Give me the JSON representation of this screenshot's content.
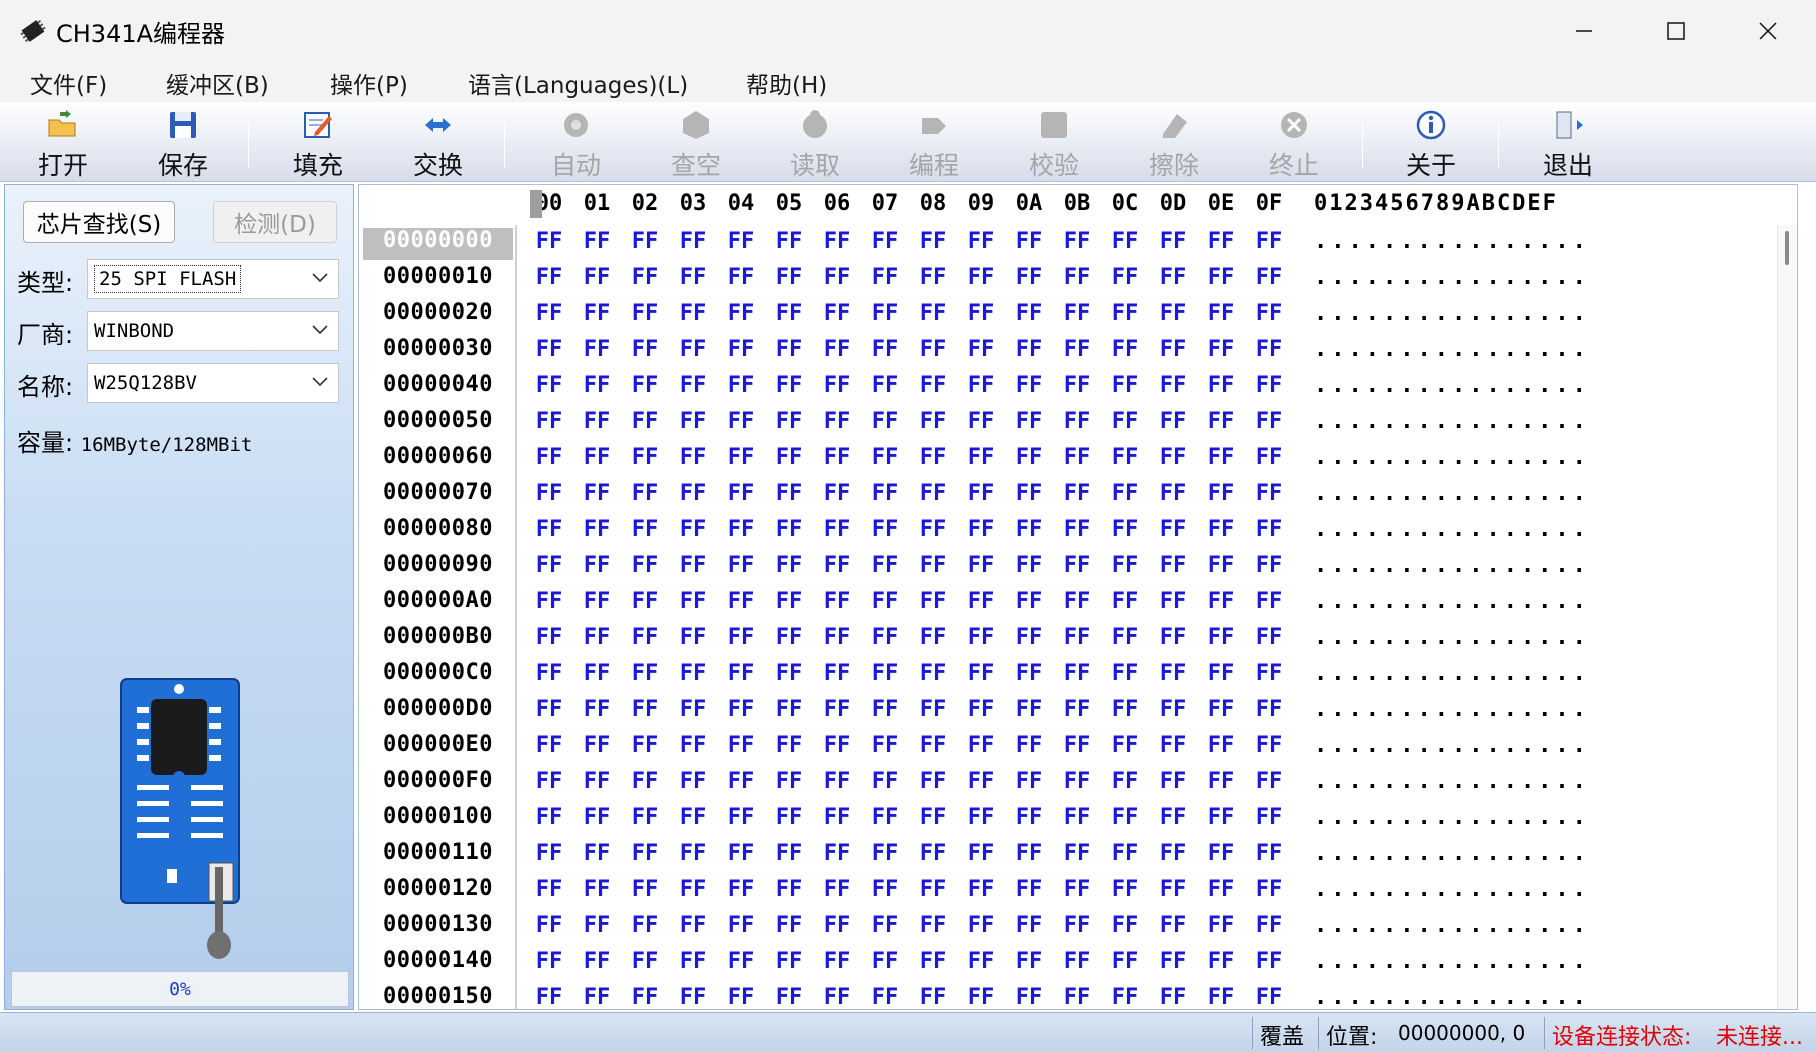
{
  "window": {
    "title": "CH341A编程器",
    "minimize": "—",
    "maximize": "☐",
    "close": "✕"
  },
  "menu": [
    "文件(F)",
    "缓冲区(B)",
    "操作(P)",
    "语言(Languages)(L)",
    "帮助(H)"
  ],
  "toolbar": {
    "open": "打开",
    "save": "保存",
    "fill": "填充",
    "swap": "交换",
    "auto": "自动",
    "blank": "查空",
    "read": "读取",
    "program": "编程",
    "verify": "校验",
    "erase": "擦除",
    "stop": "终止",
    "about": "关于",
    "exit": "退出"
  },
  "left_panel": {
    "chip_search_button": "芯片查找(S)",
    "detect_button": "检测(D)",
    "type_label": "类型:",
    "type_value": "25 SPI FLASH",
    "vendor_label": "厂商:",
    "vendor_value": "WINBOND",
    "name_label": "名称:",
    "name_value": "W25Q128BV",
    "capacity_label": "容量:",
    "capacity_value": "16MByte/128MBit",
    "progress": 0,
    "progress_text": "0%"
  },
  "hex_view": {
    "columns": [
      "00",
      "01",
      "02",
      "03",
      "04",
      "05",
      "06",
      "07",
      "08",
      "09",
      "0A",
      "0B",
      "0C",
      "0D",
      "0E",
      "0F"
    ],
    "ascii_header": "0123456789ABCDEF",
    "rows": [
      {
        "addr": "00000000",
        "bytes": [
          "FF",
          "FF",
          "FF",
          "FF",
          "FF",
          "FF",
          "FF",
          "FF",
          "FF",
          "FF",
          "FF",
          "FF",
          "FF",
          "FF",
          "FF",
          "FF"
        ],
        "ascii": "................"
      },
      {
        "addr": "00000010",
        "bytes": [
          "FF",
          "FF",
          "FF",
          "FF",
          "FF",
          "FF",
          "FF",
          "FF",
          "FF",
          "FF",
          "FF",
          "FF",
          "FF",
          "FF",
          "FF",
          "FF"
        ],
        "ascii": "................"
      },
      {
        "addr": "00000020",
        "bytes": [
          "FF",
          "FF",
          "FF",
          "FF",
          "FF",
          "FF",
          "FF",
          "FF",
          "FF",
          "FF",
          "FF",
          "FF",
          "FF",
          "FF",
          "FF",
          "FF"
        ],
        "ascii": "................"
      },
      {
        "addr": "00000030",
        "bytes": [
          "FF",
          "FF",
          "FF",
          "FF",
          "FF",
          "FF",
          "FF",
          "FF",
          "FF",
          "FF",
          "FF",
          "FF",
          "FF",
          "FF",
          "FF",
          "FF"
        ],
        "ascii": "................"
      },
      {
        "addr": "00000040",
        "bytes": [
          "FF",
          "FF",
          "FF",
          "FF",
          "FF",
          "FF",
          "FF",
          "FF",
          "FF",
          "FF",
          "FF",
          "FF",
          "FF",
          "FF",
          "FF",
          "FF"
        ],
        "ascii": "................"
      },
      {
        "addr": "00000050",
        "bytes": [
          "FF",
          "FF",
          "FF",
          "FF",
          "FF",
          "FF",
          "FF",
          "FF",
          "FF",
          "FF",
          "FF",
          "FF",
          "FF",
          "FF",
          "FF",
          "FF"
        ],
        "ascii": "................"
      },
      {
        "addr": "00000060",
        "bytes": [
          "FF",
          "FF",
          "FF",
          "FF",
          "FF",
          "FF",
          "FF",
          "FF",
          "FF",
          "FF",
          "FF",
          "FF",
          "FF",
          "FF",
          "FF",
          "FF"
        ],
        "ascii": "................"
      },
      {
        "addr": "00000070",
        "bytes": [
          "FF",
          "FF",
          "FF",
          "FF",
          "FF",
          "FF",
          "FF",
          "FF",
          "FF",
          "FF",
          "FF",
          "FF",
          "FF",
          "FF",
          "FF",
          "FF"
        ],
        "ascii": "................"
      },
      {
        "addr": "00000080",
        "bytes": [
          "FF",
          "FF",
          "FF",
          "FF",
          "FF",
          "FF",
          "FF",
          "FF",
          "FF",
          "FF",
          "FF",
          "FF",
          "FF",
          "FF",
          "FF",
          "FF"
        ],
        "ascii": "................"
      },
      {
        "addr": "00000090",
        "bytes": [
          "FF",
          "FF",
          "FF",
          "FF",
          "FF",
          "FF",
          "FF",
          "FF",
          "FF",
          "FF",
          "FF",
          "FF",
          "FF",
          "FF",
          "FF",
          "FF"
        ],
        "ascii": "................"
      },
      {
        "addr": "000000A0",
        "bytes": [
          "FF",
          "FF",
          "FF",
          "FF",
          "FF",
          "FF",
          "FF",
          "FF",
          "FF",
          "FF",
          "FF",
          "FF",
          "FF",
          "FF",
          "FF",
          "FF"
        ],
        "ascii": "................"
      },
      {
        "addr": "000000B0",
        "bytes": [
          "FF",
          "FF",
          "FF",
          "FF",
          "FF",
          "FF",
          "FF",
          "FF",
          "FF",
          "FF",
          "FF",
          "FF",
          "FF",
          "FF",
          "FF",
          "FF"
        ],
        "ascii": "................"
      },
      {
        "addr": "000000C0",
        "bytes": [
          "FF",
          "FF",
          "FF",
          "FF",
          "FF",
          "FF",
          "FF",
          "FF",
          "FF",
          "FF",
          "FF",
          "FF",
          "FF",
          "FF",
          "FF",
          "FF"
        ],
        "ascii": "................"
      },
      {
        "addr": "000000D0",
        "bytes": [
          "FF",
          "FF",
          "FF",
          "FF",
          "FF",
          "FF",
          "FF",
          "FF",
          "FF",
          "FF",
          "FF",
          "FF",
          "FF",
          "FF",
          "FF",
          "FF"
        ],
        "ascii": "................"
      },
      {
        "addr": "000000E0",
        "bytes": [
          "FF",
          "FF",
          "FF",
          "FF",
          "FF",
          "FF",
          "FF",
          "FF",
          "FF",
          "FF",
          "FF",
          "FF",
          "FF",
          "FF",
          "FF",
          "FF"
        ],
        "ascii": "................"
      },
      {
        "addr": "000000F0",
        "bytes": [
          "FF",
          "FF",
          "FF",
          "FF",
          "FF",
          "FF",
          "FF",
          "FF",
          "FF",
          "FF",
          "FF",
          "FF",
          "FF",
          "FF",
          "FF",
          "FF"
        ],
        "ascii": "................"
      },
      {
        "addr": "00000100",
        "bytes": [
          "FF",
          "FF",
          "FF",
          "FF",
          "FF",
          "FF",
          "FF",
          "FF",
          "FF",
          "FF",
          "FF",
          "FF",
          "FF",
          "FF",
          "FF",
          "FF"
        ],
        "ascii": "................"
      },
      {
        "addr": "00000110",
        "bytes": [
          "FF",
          "FF",
          "FF",
          "FF",
          "FF",
          "FF",
          "FF",
          "FF",
          "FF",
          "FF",
          "FF",
          "FF",
          "FF",
          "FF",
          "FF",
          "FF"
        ],
        "ascii": "................"
      },
      {
        "addr": "00000120",
        "bytes": [
          "FF",
          "FF",
          "FF",
          "FF",
          "FF",
          "FF",
          "FF",
          "FF",
          "FF",
          "FF",
          "FF",
          "FF",
          "FF",
          "FF",
          "FF",
          "FF"
        ],
        "ascii": "................"
      },
      {
        "addr": "00000130",
        "bytes": [
          "FF",
          "FF",
          "FF",
          "FF",
          "FF",
          "FF",
          "FF",
          "FF",
          "FF",
          "FF",
          "FF",
          "FF",
          "FF",
          "FF",
          "FF",
          "FF"
        ],
        "ascii": "................"
      },
      {
        "addr": "00000140",
        "bytes": [
          "FF",
          "FF",
          "FF",
          "FF",
          "FF",
          "FF",
          "FF",
          "FF",
          "FF",
          "FF",
          "FF",
          "FF",
          "FF",
          "FF",
          "FF",
          "FF"
        ],
        "ascii": "................"
      },
      {
        "addr": "00000150",
        "bytes": [
          "FF",
          "FF",
          "FF",
          "FF",
          "FF",
          "FF",
          "FF",
          "FF",
          "FF",
          "FF",
          "FF",
          "FF",
          "FF",
          "FF",
          "FF",
          "FF"
        ],
        "ascii": "................"
      }
    ]
  },
  "status_bar": {
    "mode": "覆盖",
    "position_label": "位置:",
    "position_value": "00000000, 0",
    "connection_label": "设备连接状态:",
    "connection_value": "未连接..."
  },
  "colors": {
    "hex_bytes": "#1919d6",
    "status_connection": "#e00000",
    "panel_blue": "#c9ddf3"
  }
}
